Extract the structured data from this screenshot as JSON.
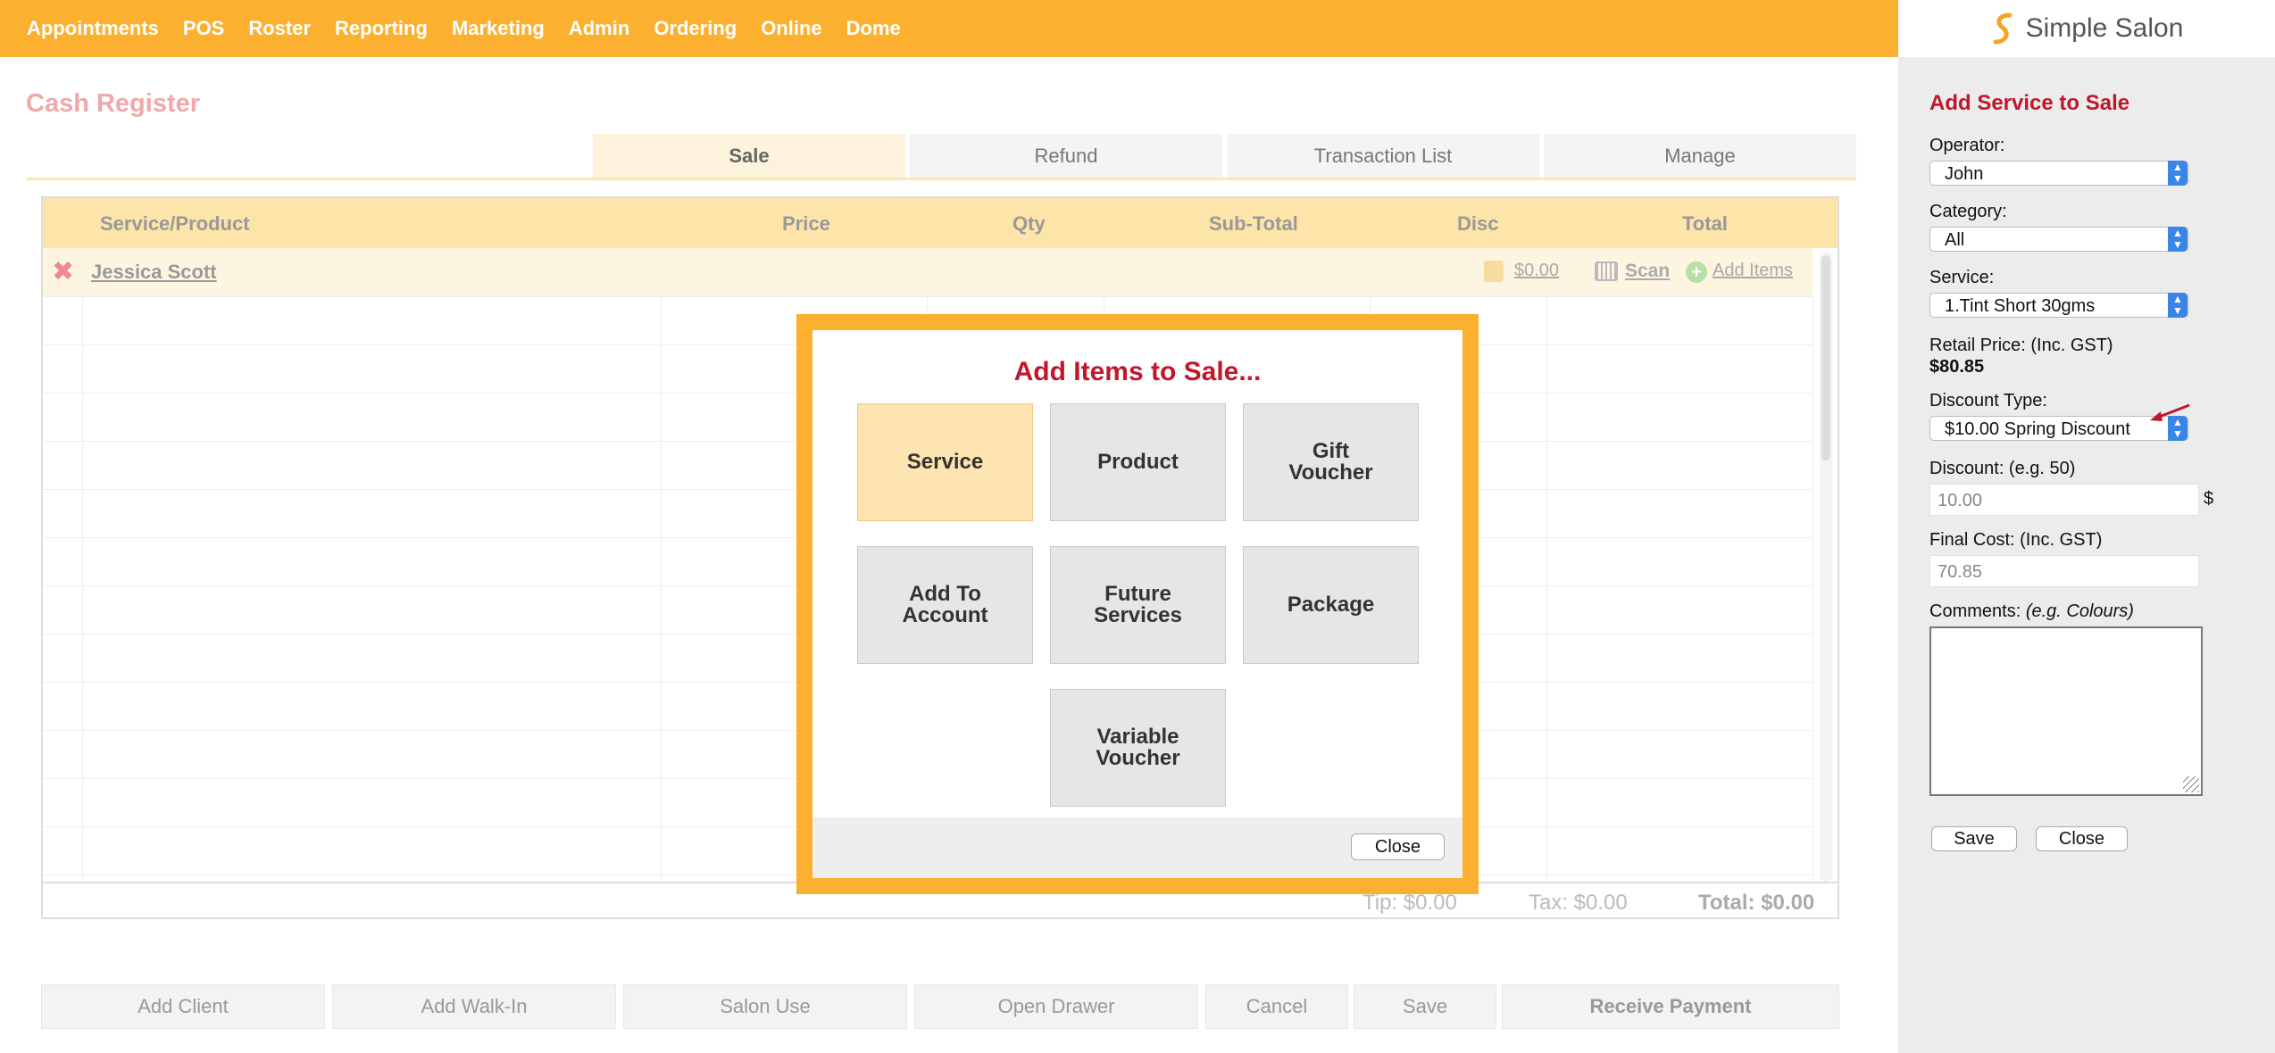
{
  "nav": {
    "items": [
      "Appointments",
      "POS",
      "Roster",
      "Reporting",
      "Marketing",
      "Admin",
      "Ordering",
      "Online",
      "Dome"
    ],
    "logo_text": "Simple Salon"
  },
  "page": {
    "title": "Cash Register"
  },
  "tabs": [
    {
      "label": "Sale",
      "active": true
    },
    {
      "label": "Refund",
      "active": false
    },
    {
      "label": "Transaction List",
      "active": false
    },
    {
      "label": "Manage",
      "active": false
    }
  ],
  "table": {
    "columns": [
      "Service/Product",
      "Price",
      "Qty",
      "Sub-Total",
      "Disc",
      "Total"
    ],
    "client_row": {
      "client_name": "Jessica Scott",
      "tip_amount": "$0.00",
      "scan_label": "Scan",
      "add_items_label": "Add Items"
    },
    "totals": {
      "tip": "Tip: $0.00",
      "tax": "Tax: $0.00",
      "total": "Total: $0.00"
    }
  },
  "footer_buttons": [
    "Add Client",
    "Add Walk-In",
    "Salon Use",
    "Open Drawer",
    "Cancel",
    "Save",
    "Receive Payment"
  ],
  "modal": {
    "title": "Add Items to Sale...",
    "tiles": [
      "Service",
      "Product",
      "Gift Voucher",
      "Add To Account",
      "Future Services",
      "Package",
      "Variable Voucher"
    ],
    "selected_tile": "Service",
    "close_label": "Close"
  },
  "side_panel": {
    "title": "Add Service to Sale",
    "operator_label": "Operator:",
    "operator_value": "John",
    "category_label": "Category:",
    "category_value": "All",
    "service_label": "Service:",
    "service_value": "1.Tint Short 30gms",
    "retail_price_label": "Retail Price: (Inc. GST)",
    "retail_price_value": "$80.85",
    "discount_type_label": "Discount Type:",
    "discount_type_value": "$10.00 Spring Discount",
    "discount_label": "Discount: (e.g. 50)",
    "discount_value": "10.00",
    "discount_unit": "$",
    "final_cost_label": "Final Cost: (Inc. GST)",
    "final_cost_value": "70.85",
    "comments_label": "Comments:",
    "comments_hint": "(e.g. Colours)",
    "save_label": "Save",
    "close_label": "Close"
  },
  "colors": {
    "brand": "#fbb12f",
    "title_red": "#c0172c",
    "header_bg": "#fde4a9"
  }
}
